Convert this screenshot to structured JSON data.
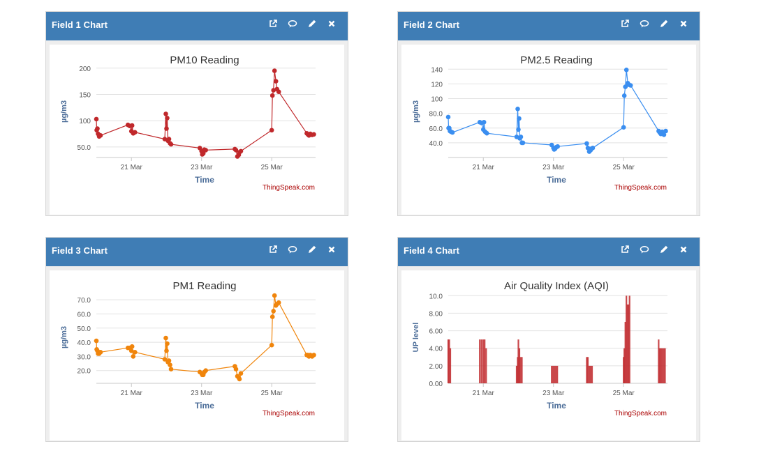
{
  "panels": [
    {
      "header": "Field 1 Chart"
    },
    {
      "header": "Field 2 Chart"
    },
    {
      "header": "Field 3 Chart"
    },
    {
      "header": "Field 4 Chart"
    }
  ],
  "icons": [
    "external-link-icon",
    "comment-icon",
    "pencil-icon",
    "close-icon"
  ],
  "chart_data": [
    {
      "type": "line",
      "title": "PM10 Reading",
      "xlabel": "Time",
      "ylabel": "µg/m3",
      "credit": "ThingSpeak.com",
      "color": "#c0282b",
      "x_ticks": [
        {
          "day": 21,
          "label": "21 Mar"
        },
        {
          "day": 23,
          "label": "23 Mar"
        },
        {
          "day": 25,
          "label": "25 Mar"
        }
      ],
      "x_range_day": [
        20.0,
        26.25
      ],
      "y_ticks": [
        {
          "value": 50,
          "label": "50.0"
        },
        {
          "value": 100,
          "label": "100"
        },
        {
          "value": 150,
          "label": "150"
        },
        {
          "value": 200,
          "label": "200"
        }
      ],
      "ylim": [
        30,
        205
      ],
      "grid": true,
      "points": [
        [
          20.0,
          103
        ],
        [
          20.01,
          82
        ],
        [
          20.03,
          85
        ],
        [
          20.05,
          75
        ],
        [
          20.08,
          70
        ],
        [
          20.12,
          72
        ],
        [
          20.9,
          92
        ],
        [
          20.95,
          90
        ],
        [
          21.0,
          80
        ],
        [
          21.02,
          91
        ],
        [
          21.05,
          76
        ],
        [
          21.1,
          78
        ],
        [
          21.95,
          65
        ],
        [
          21.98,
          113
        ],
        [
          22.0,
          85
        ],
        [
          22.02,
          105
        ],
        [
          22.04,
          62
        ],
        [
          22.07,
          65
        ],
        [
          22.1,
          57
        ],
        [
          22.13,
          55
        ],
        [
          22.95,
          48
        ],
        [
          23.0,
          42
        ],
        [
          23.02,
          36
        ],
        [
          23.05,
          38
        ],
        [
          23.08,
          45
        ],
        [
          23.12,
          44
        ],
        [
          23.95,
          46
        ],
        [
          23.98,
          44
        ],
        [
          24.02,
          32
        ],
        [
          24.06,
          35
        ],
        [
          24.08,
          40
        ],
        [
          24.12,
          42
        ],
        [
          25.0,
          82
        ],
        [
          25.02,
          148
        ],
        [
          25.05,
          158
        ],
        [
          25.08,
          195
        ],
        [
          25.12,
          175
        ],
        [
          25.15,
          160
        ],
        [
          25.2,
          155
        ],
        [
          26.0,
          76
        ],
        [
          26.03,
          74
        ],
        [
          26.06,
          72
        ],
        [
          26.1,
          75
        ],
        [
          26.15,
          73
        ],
        [
          26.2,
          74
        ]
      ]
    },
    {
      "type": "line",
      "title": "PM2.5 Reading",
      "xlabel": "Time",
      "ylabel": "µg/m3",
      "credit": "ThingSpeak.com",
      "color": "#3a8ef0",
      "x_ticks": [
        {
          "day": 21,
          "label": "21 Mar"
        },
        {
          "day": 23,
          "label": "23 Mar"
        },
        {
          "day": 25,
          "label": "25 Mar"
        }
      ],
      "x_range_day": [
        20.0,
        26.25
      ],
      "y_ticks": [
        {
          "value": 40,
          "label": "40.0"
        },
        {
          "value": 60,
          "label": "60.0"
        },
        {
          "value": 80,
          "label": "80.0"
        },
        {
          "value": 100,
          "label": "100"
        },
        {
          "value": 120,
          "label": "120"
        },
        {
          "value": 140,
          "label": "140"
        }
      ],
      "ylim": [
        20,
        145
      ],
      "grid": true,
      "points": [
        [
          20.0,
          75
        ],
        [
          20.01,
          60
        ],
        [
          20.03,
          60
        ],
        [
          20.05,
          56
        ],
        [
          20.08,
          55
        ],
        [
          20.12,
          54
        ],
        [
          20.9,
          68
        ],
        [
          20.95,
          67
        ],
        [
          21.0,
          58
        ],
        [
          21.02,
          68
        ],
        [
          21.05,
          55
        ],
        [
          21.1,
          53
        ],
        [
          21.95,
          48
        ],
        [
          21.98,
          86
        ],
        [
          22.0,
          58
        ],
        [
          22.02,
          73
        ],
        [
          22.04,
          46
        ],
        [
          22.07,
          48
        ],
        [
          22.1,
          40
        ],
        [
          22.13,
          40
        ],
        [
          22.95,
          37
        ],
        [
          23.0,
          33
        ],
        [
          23.02,
          31
        ],
        [
          23.05,
          32
        ],
        [
          23.08,
          34
        ],
        [
          23.12,
          35
        ],
        [
          23.95,
          39
        ],
        [
          23.98,
          33
        ],
        [
          24.02,
          28
        ],
        [
          24.06,
          30
        ],
        [
          24.08,
          32
        ],
        [
          24.12,
          33
        ],
        [
          25.0,
          61
        ],
        [
          25.02,
          104
        ],
        [
          25.05,
          116
        ],
        [
          25.08,
          139
        ],
        [
          25.12,
          121
        ],
        [
          25.15,
          119
        ],
        [
          25.2,
          118
        ],
        [
          26.0,
          56
        ],
        [
          26.03,
          54
        ],
        [
          26.06,
          52
        ],
        [
          26.1,
          55
        ],
        [
          26.15,
          51
        ],
        [
          26.2,
          56
        ]
      ]
    },
    {
      "type": "line",
      "title": "PM1 Reading",
      "xlabel": "Time",
      "ylabel": "µg/m3",
      "credit": "ThingSpeak.com",
      "color": "#f0850c",
      "x_ticks": [
        {
          "day": 21,
          "label": "21 Mar"
        },
        {
          "day": 23,
          "label": "23 Mar"
        },
        {
          "day": 25,
          "label": "25 Mar"
        }
      ],
      "x_range_day": [
        20.0,
        26.25
      ],
      "y_ticks": [
        {
          "value": 20,
          "label": "20.0"
        },
        {
          "value": 30,
          "label": "30.0"
        },
        {
          "value": 40,
          "label": "40.0"
        },
        {
          "value": 50,
          "label": "50.0"
        },
        {
          "value": 60,
          "label": "60.0"
        },
        {
          "value": 70,
          "label": "70.0"
        }
      ],
      "ylim": [
        11,
        76
      ],
      "grid": true,
      "points": [
        [
          20.0,
          41
        ],
        [
          20.01,
          35
        ],
        [
          20.03,
          34
        ],
        [
          20.05,
          32
        ],
        [
          20.08,
          32
        ],
        [
          20.12,
          33
        ],
        [
          20.9,
          36
        ],
        [
          20.95,
          36
        ],
        [
          21.0,
          34
        ],
        [
          21.02,
          37
        ],
        [
          21.05,
          30
        ],
        [
          21.1,
          33
        ],
        [
          21.95,
          28
        ],
        [
          21.98,
          43
        ],
        [
          22.0,
          34
        ],
        [
          22.02,
          39
        ],
        [
          22.04,
          26
        ],
        [
          22.07,
          27
        ],
        [
          22.1,
          24
        ],
        [
          22.13,
          21
        ],
        [
          22.95,
          19
        ],
        [
          23.0,
          18
        ],
        [
          23.02,
          17
        ],
        [
          23.05,
          17
        ],
        [
          23.08,
          19
        ],
        [
          23.12,
          20
        ],
        [
          23.95,
          23
        ],
        [
          23.98,
          21
        ],
        [
          24.02,
          16
        ],
        [
          24.06,
          15
        ],
        [
          24.08,
          14
        ],
        [
          24.12,
          18
        ],
        [
          25.0,
          38
        ],
        [
          25.02,
          58
        ],
        [
          25.05,
          62
        ],
        [
          25.08,
          73
        ],
        [
          25.12,
          66
        ],
        [
          25.15,
          67
        ],
        [
          25.2,
          68
        ],
        [
          26.0,
          31
        ],
        [
          26.03,
          31
        ],
        [
          26.06,
          30
        ],
        [
          26.1,
          31
        ],
        [
          26.15,
          30
        ],
        [
          26.2,
          31
        ]
      ]
    },
    {
      "type": "bar",
      "title": "Air Quality Index (AQI)",
      "xlabel": "Time",
      "ylabel": "UP level",
      "credit": "ThingSpeak.com",
      "color": "#c0282b",
      "x_ticks": [
        {
          "day": 21,
          "label": "21 Mar"
        },
        {
          "day": 23,
          "label": "23 Mar"
        },
        {
          "day": 25,
          "label": "25 Mar"
        }
      ],
      "x_range_day": [
        20.0,
        26.25
      ],
      "y_ticks": [
        {
          "value": 0,
          "label": "0.00"
        },
        {
          "value": 2,
          "label": "2.00"
        },
        {
          "value": 4,
          "label": "4.00"
        },
        {
          "value": 6,
          "label": "6.00"
        },
        {
          "value": 8,
          "label": "8.00"
        },
        {
          "value": 10,
          "label": "10.0"
        }
      ],
      "ylim": [
        0,
        10.5
      ],
      "grid": true,
      "bars": [
        [
          20.0,
          5
        ],
        [
          20.03,
          5
        ],
        [
          20.06,
          4
        ],
        [
          20.9,
          5
        ],
        [
          20.95,
          5
        ],
        [
          21.0,
          5
        ],
        [
          21.04,
          5
        ],
        [
          21.08,
          4
        ],
        [
          21.95,
          2
        ],
        [
          21.98,
          3
        ],
        [
          22.0,
          5
        ],
        [
          22.03,
          4
        ],
        [
          22.06,
          3
        ],
        [
          22.1,
          3
        ],
        [
          22.95,
          2
        ],
        [
          22.99,
          2
        ],
        [
          23.03,
          2
        ],
        [
          23.07,
          2
        ],
        [
          23.11,
          2
        ],
        [
          23.95,
          3
        ],
        [
          23.98,
          3
        ],
        [
          24.02,
          2
        ],
        [
          24.06,
          2
        ],
        [
          24.1,
          2
        ],
        [
          25.0,
          3
        ],
        [
          25.02,
          4
        ],
        [
          25.05,
          7
        ],
        [
          25.08,
          10
        ],
        [
          25.11,
          9
        ],
        [
          25.14,
          9
        ],
        [
          25.17,
          10
        ],
        [
          26.0,
          5
        ],
        [
          26.03,
          4
        ],
        [
          26.06,
          4
        ],
        [
          26.1,
          4
        ],
        [
          26.14,
          4
        ],
        [
          26.18,
          4
        ]
      ]
    }
  ]
}
